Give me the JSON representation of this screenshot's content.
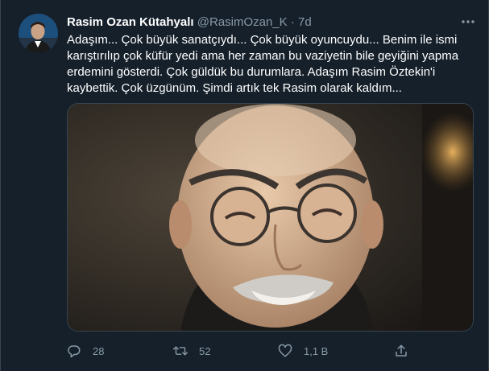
{
  "tweet": {
    "author_name": "Rasim Ozan Kütahyalı",
    "handle": "@RasimOzan_K",
    "separator": "·",
    "time": "7d",
    "text": "Adaşım... Çok büyük sanatçıydı... Çok büyük oyuncuydu... Benim ile ismi\nkarıştırılıp çok küfür yedi ama her zaman bu vaziyetin bile geyiğini yapma\nerdemini gösterdi. Çok güldük bu durumlara. Adaşım Rasim Öztekin'i\nkaybettik. Çok üzgünüm. Şimdi artık tek Rasim olarak kaldım..."
  },
  "actions": {
    "reply_count": "28",
    "retweet_count": "52",
    "like_count": "1,1 B"
  },
  "icons": {
    "more": "more-icon",
    "reply": "reply-icon",
    "retweet": "retweet-icon",
    "like": "heart-icon",
    "share": "share-icon"
  },
  "colors": {
    "background": "#15202b",
    "muted": "#8899a6",
    "border": "#38444d"
  }
}
